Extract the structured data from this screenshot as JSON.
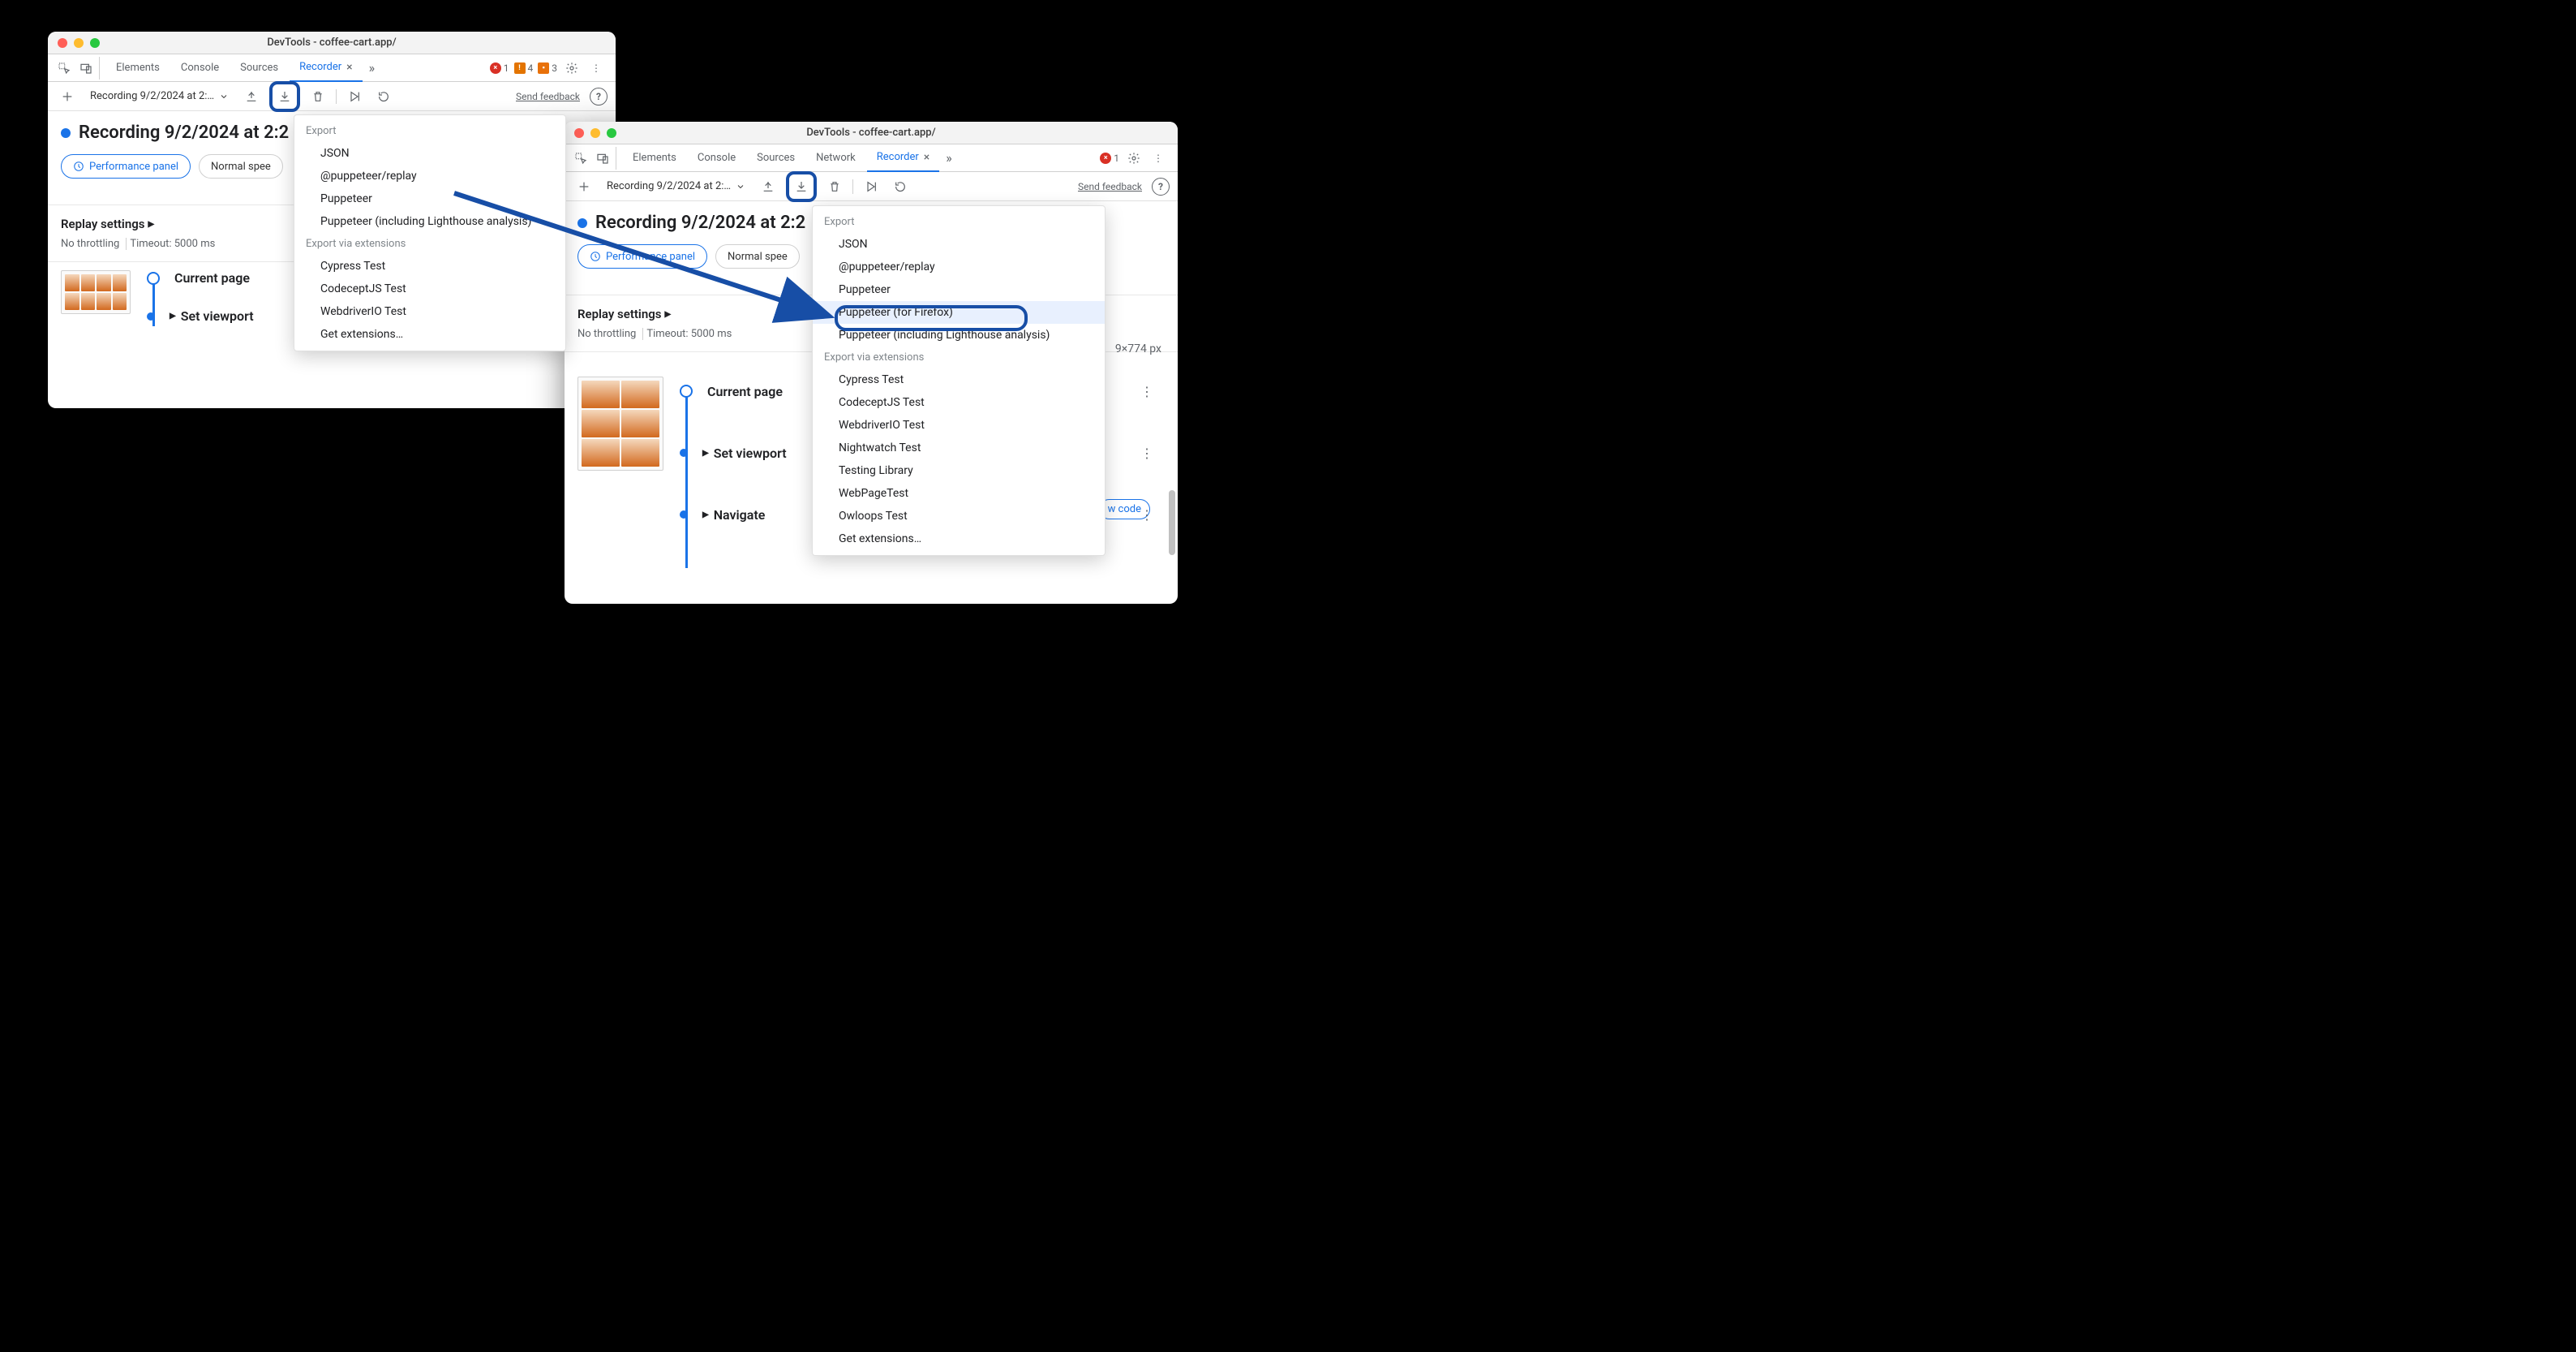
{
  "window1": {
    "title": "DevTools - coffee-cart.app/",
    "tabs": [
      "Elements",
      "Console",
      "Sources",
      "Recorder"
    ],
    "active_tab": "Recorder",
    "status": {
      "errors": "1",
      "warnings": "4",
      "issues": "3"
    },
    "toolbar": {
      "recording_select": "Recording 9/2/2024 at 2:…",
      "feedback": "Send feedback"
    },
    "heading": "Recording 9/2/2024 at 2:2",
    "chips": {
      "perf": "Performance panel",
      "speed": "Normal spee"
    },
    "replay": {
      "title": "Replay settings",
      "throttling": "No throttling",
      "timeout": "Timeout: 5000 ms"
    },
    "steps": {
      "current": "Current page",
      "viewport": "Set viewport"
    },
    "menu": {
      "export_hdr": "Export",
      "items": [
        "JSON",
        "@puppeteer/replay",
        "Puppeteer",
        "Puppeteer (including Lighthouse analysis)"
      ],
      "ext_hdr": "Export via extensions",
      "ext_items": [
        "Cypress Test",
        "CodeceptJS Test",
        "WebdriverIO Test",
        "Get extensions…"
      ]
    }
  },
  "window2": {
    "title": "DevTools - coffee-cart.app/",
    "tabs": [
      "Elements",
      "Console",
      "Sources",
      "Network",
      "Recorder"
    ],
    "active_tab": "Recorder",
    "status": {
      "errors": "1"
    },
    "toolbar": {
      "recording_select": "Recording 9/2/2024 at 2:…",
      "feedback": "Send feedback"
    },
    "heading": "Recording 9/2/2024 at 2:2",
    "chips": {
      "perf": "Performance panel",
      "speed": "Normal spee"
    },
    "replay": {
      "title": "Replay settings",
      "throttling": "No throttling",
      "timeout": "Timeout: 5000 ms"
    },
    "dimensions_partial": "9×774 px",
    "show_code": "w code",
    "steps": {
      "current": "Current page",
      "viewport": "Set viewport",
      "navigate": "Navigate"
    },
    "menu": {
      "export_hdr": "Export",
      "items": [
        "JSON",
        "@puppeteer/replay",
        "Puppeteer",
        "Puppeteer (for Firefox)",
        "Puppeteer (including Lighthouse analysis)"
      ],
      "ext_hdr": "Export via extensions",
      "ext_items": [
        "Cypress Test",
        "CodeceptJS Test",
        "WebdriverIO Test",
        "Nightwatch Test",
        "Testing Library",
        "WebPageTest",
        "Owloops Test",
        "Get extensions…"
      ]
    }
  }
}
